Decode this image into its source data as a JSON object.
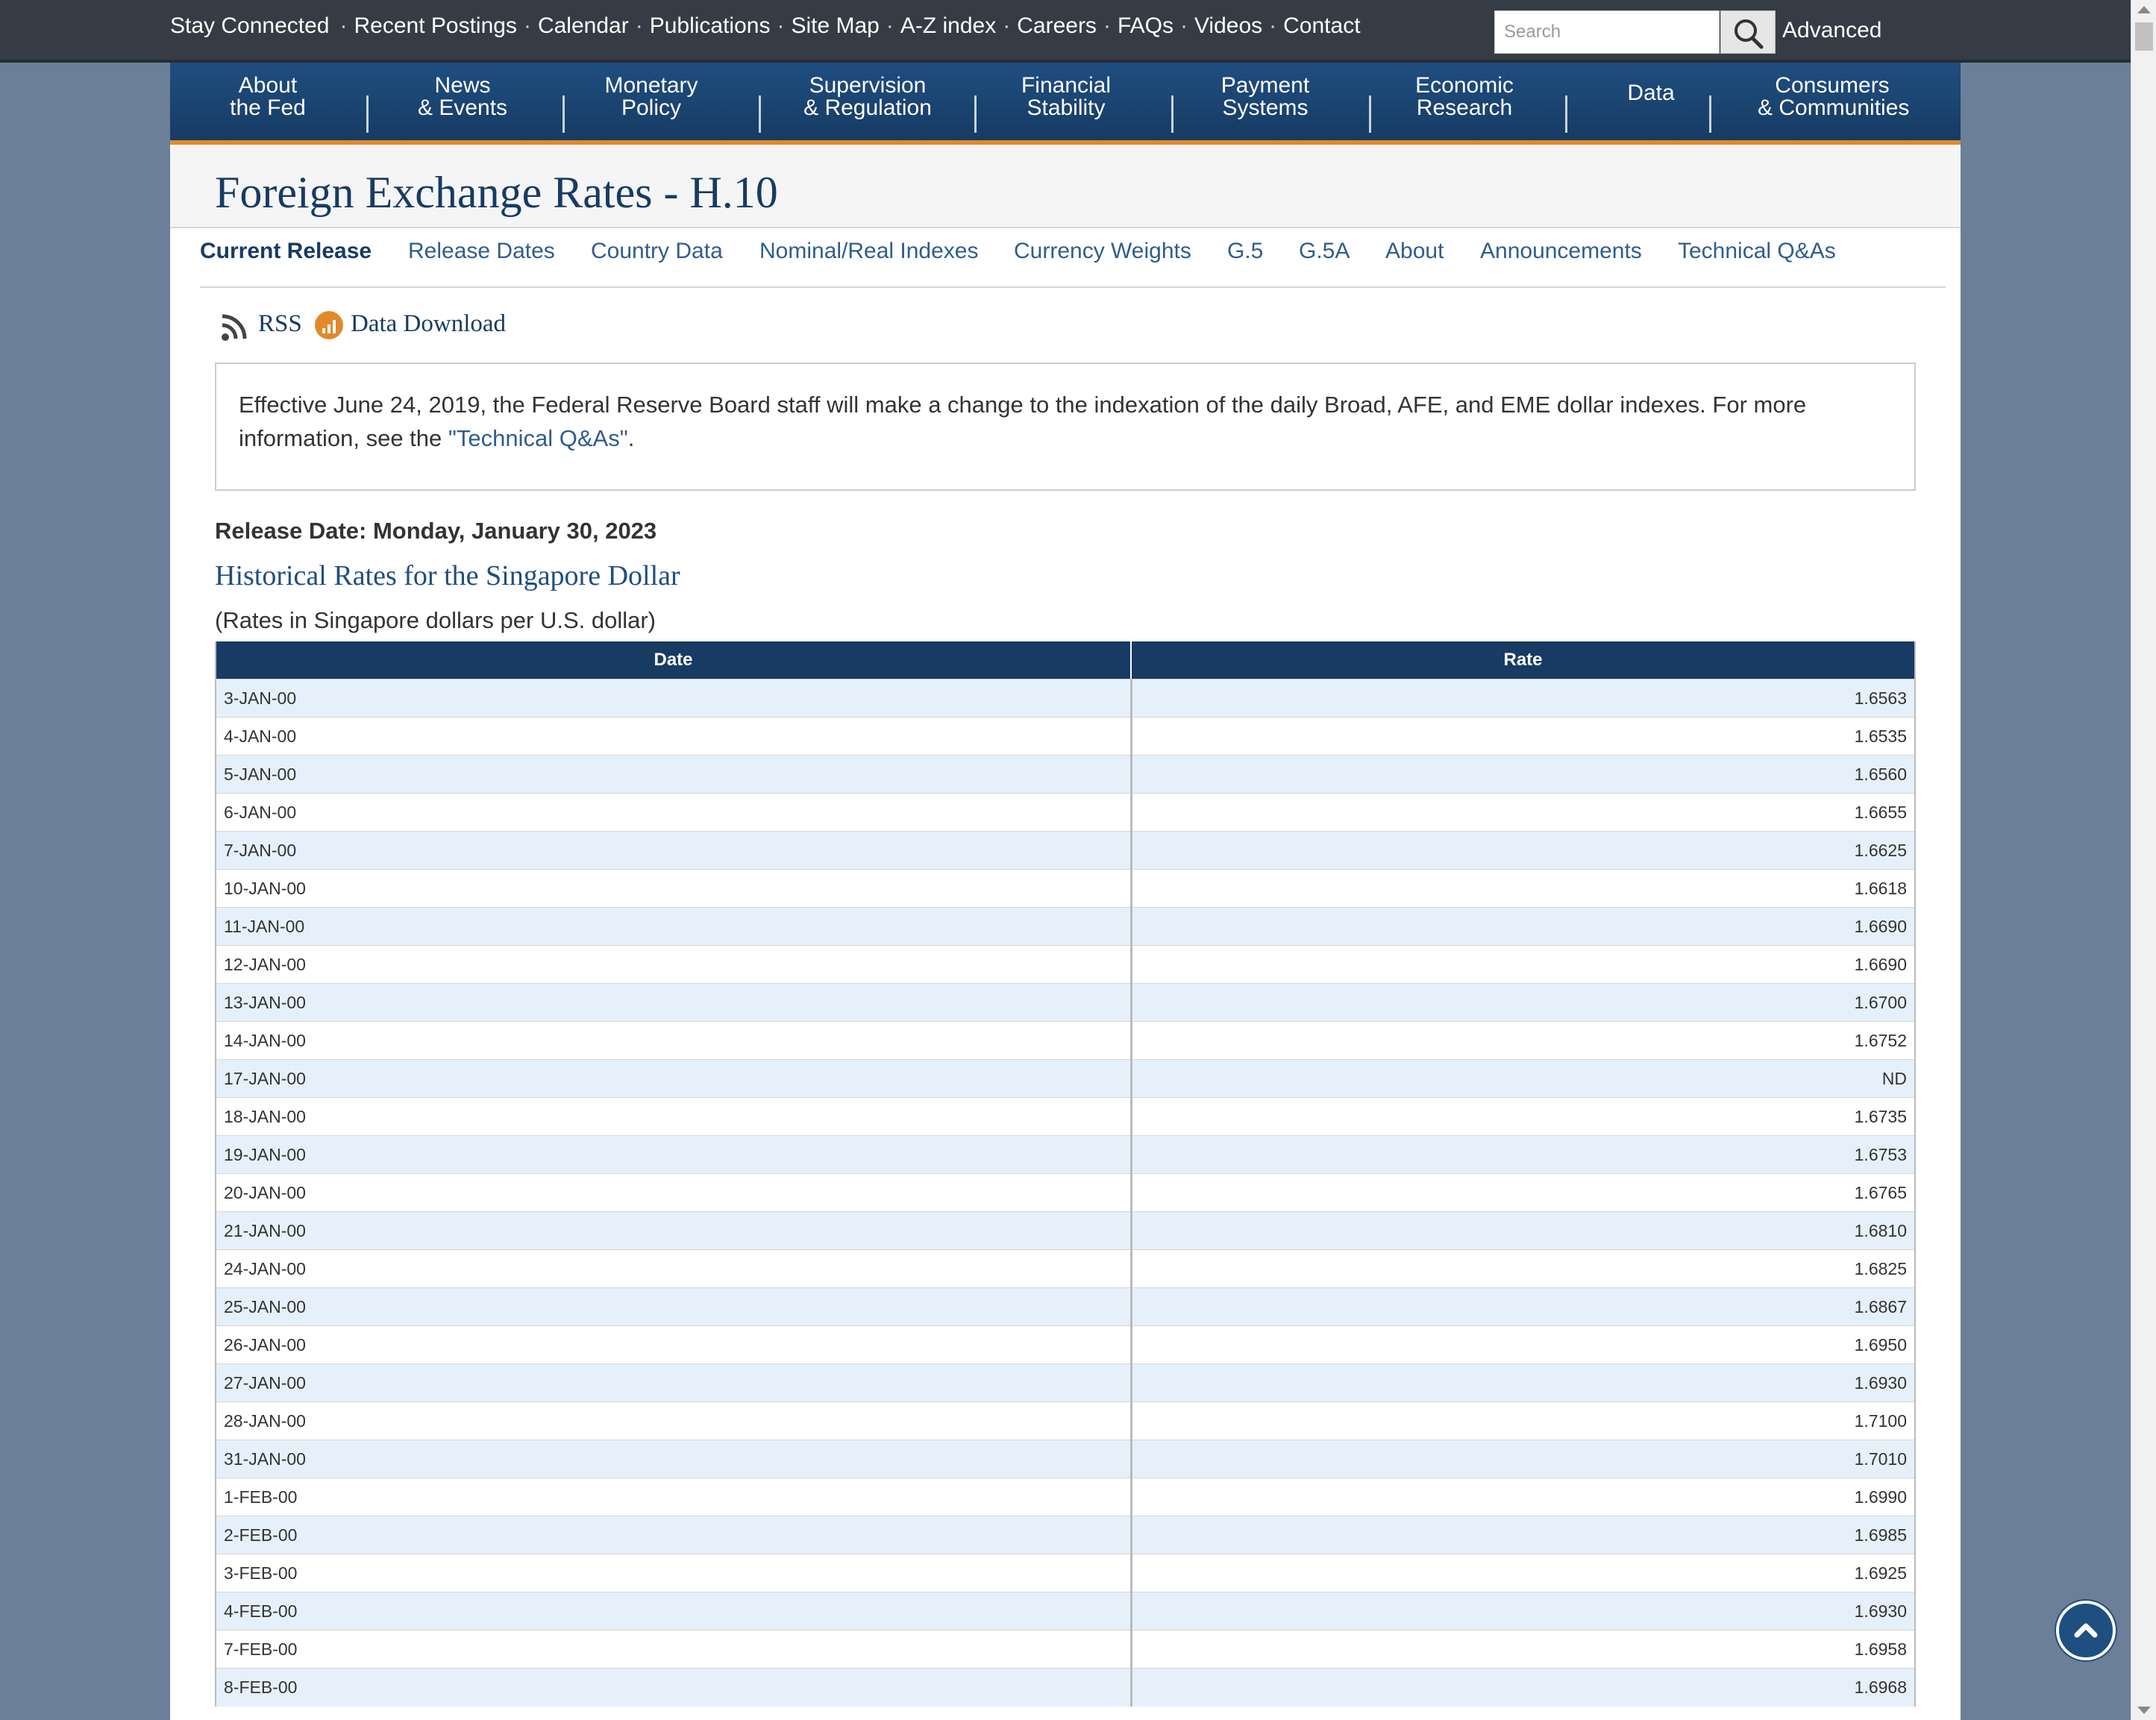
{
  "topbar": {
    "links": [
      "Stay Connected",
      "Recent Postings",
      "Calendar",
      "Publications",
      "Site Map",
      "A-Z index",
      "Careers",
      "FAQs",
      "Videos",
      "Contact"
    ],
    "search_placeholder": "Search",
    "advanced_label": "Advanced",
    "search_icon": "magnifier-icon"
  },
  "mainnav": [
    {
      "line1": "About",
      "line2": "the Fed"
    },
    {
      "line1": "News",
      "line2": "& Events"
    },
    {
      "line1": "Monetary",
      "line2": "Policy"
    },
    {
      "line1": "Supervision",
      "line2": "& Regulation"
    },
    {
      "line1": "Financial",
      "line2": "Stability"
    },
    {
      "line1": "Payment",
      "line2": "Systems"
    },
    {
      "line1": "Economic",
      "line2": "Research"
    },
    {
      "line1": "Data",
      "line2": ""
    },
    {
      "line1": "Consumers",
      "line2": "& Communities"
    }
  ],
  "page": {
    "title": "Foreign Exchange Rates - H.10",
    "subnav": [
      "Current Release",
      "Release Dates",
      "Country Data",
      "Nominal/Real Indexes",
      "Currency Weights",
      "G.5",
      "G.5A",
      "About",
      "Announcements",
      "Technical Q&As"
    ],
    "active_subnav": "Current Release",
    "rss_label": "RSS",
    "download_label": "Data Download",
    "notice_text": "Effective June 24, 2019, the Federal Reserve Board staff will make a change to the indexation of the daily Broad, AFE, and EME dollar indexes. For more information, see the ",
    "notice_link": "\"Technical Q&As\"",
    "notice_end": ".",
    "release_date": "Release Date: Monday, January 30, 2023",
    "hist_title": "Historical Rates for the Singapore Dollar",
    "units": "(Rates in Singapore dollars per U.S. dollar)"
  },
  "table": {
    "headers": [
      "Date",
      "Rate"
    ],
    "rows": [
      [
        "3-JAN-00",
        "1.6563"
      ],
      [
        "4-JAN-00",
        "1.6535"
      ],
      [
        "5-JAN-00",
        "1.6560"
      ],
      [
        "6-JAN-00",
        "1.6655"
      ],
      [
        "7-JAN-00",
        "1.6625"
      ],
      [
        "10-JAN-00",
        "1.6618"
      ],
      [
        "11-JAN-00",
        "1.6690"
      ],
      [
        "12-JAN-00",
        "1.6690"
      ],
      [
        "13-JAN-00",
        "1.6700"
      ],
      [
        "14-JAN-00",
        "1.6752"
      ],
      [
        "17-JAN-00",
        "ND"
      ],
      [
        "18-JAN-00",
        "1.6735"
      ],
      [
        "19-JAN-00",
        "1.6753"
      ],
      [
        "20-JAN-00",
        "1.6765"
      ],
      [
        "21-JAN-00",
        "1.6810"
      ],
      [
        "24-JAN-00",
        "1.6825"
      ],
      [
        "25-JAN-00",
        "1.6867"
      ],
      [
        "26-JAN-00",
        "1.6950"
      ],
      [
        "27-JAN-00",
        "1.6930"
      ],
      [
        "28-JAN-00",
        "1.7100"
      ],
      [
        "31-JAN-00",
        "1.7010"
      ],
      [
        "1-FEB-00",
        "1.6990"
      ],
      [
        "2-FEB-00",
        "1.6985"
      ],
      [
        "3-FEB-00",
        "1.6925"
      ],
      [
        "4-FEB-00",
        "1.6930"
      ],
      [
        "7-FEB-00",
        "1.6958"
      ],
      [
        "8-FEB-00",
        "1.6968"
      ]
    ]
  },
  "colors": {
    "nav_blue": "#173b63",
    "accent_orange": "#e08a2c",
    "link_blue": "#2f5d8e",
    "row_stripe": "#e6f0fa"
  }
}
